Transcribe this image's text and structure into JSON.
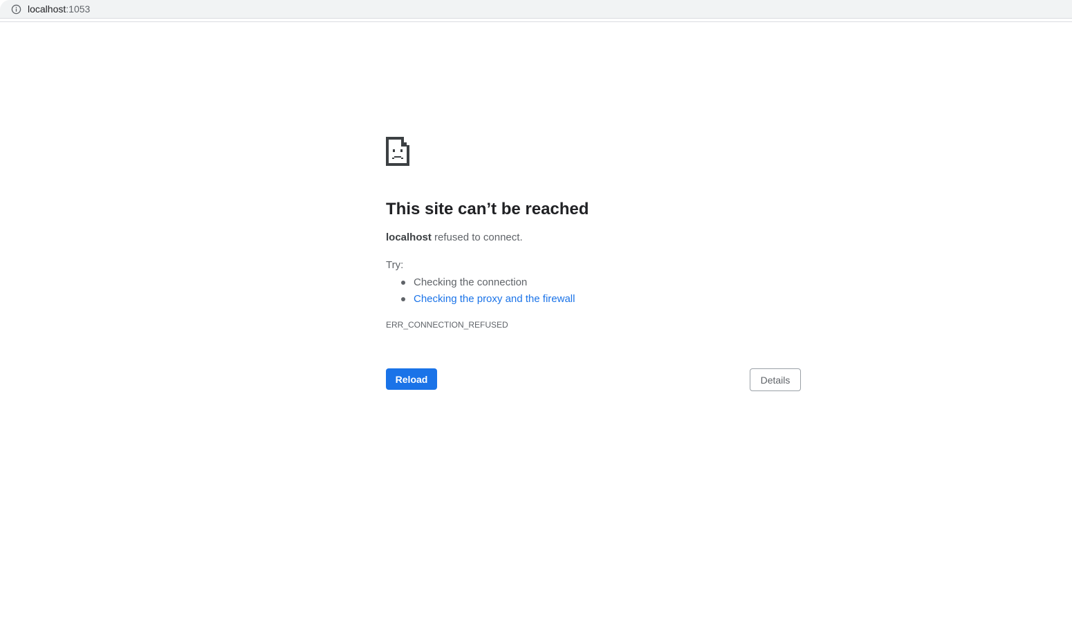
{
  "address_bar": {
    "host": "localhost",
    "port": ":1053",
    "icon": "info-icon"
  },
  "error_page": {
    "icon": "sad-page-icon",
    "title": "This site can’t be reached",
    "summary_host": "localhost",
    "summary_text": " refused to connect.",
    "try_label": "Try:",
    "suggestions": [
      {
        "label": "Checking the connection",
        "is_link": false
      },
      {
        "label": "Checking the proxy and the firewall",
        "is_link": true
      }
    ],
    "error_code": "ERR_CONNECTION_REFUSED",
    "reload_label": "Reload",
    "details_label": "Details"
  },
  "colors": {
    "accent": "#1a73e8",
    "text_primary": "#202124",
    "text_secondary": "#5f6368",
    "toolbar_bg": "#f1f3f4"
  }
}
